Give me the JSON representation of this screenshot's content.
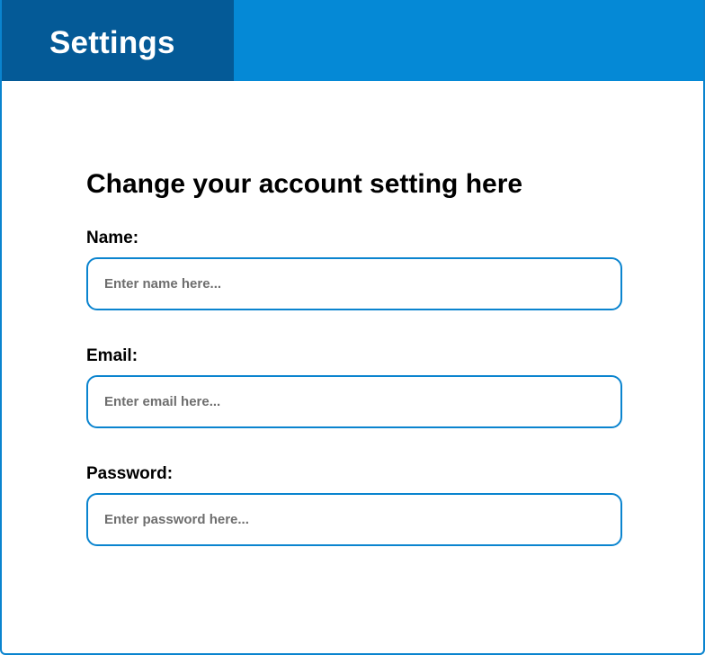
{
  "header": {
    "title": "Settings"
  },
  "form": {
    "heading": "Change your account setting here",
    "fields": [
      {
        "label": "Name:",
        "value": "",
        "placeholder": "Enter name here..."
      },
      {
        "label": "Email:",
        "value": "",
        "placeholder": "Enter email here..."
      },
      {
        "label": "Password:",
        "value": "",
        "placeholder": "Enter password here..."
      }
    ]
  },
  "colors": {
    "header_bar": "#0589d6",
    "header_tab": "#045a97",
    "input_border": "#0a84cf"
  }
}
